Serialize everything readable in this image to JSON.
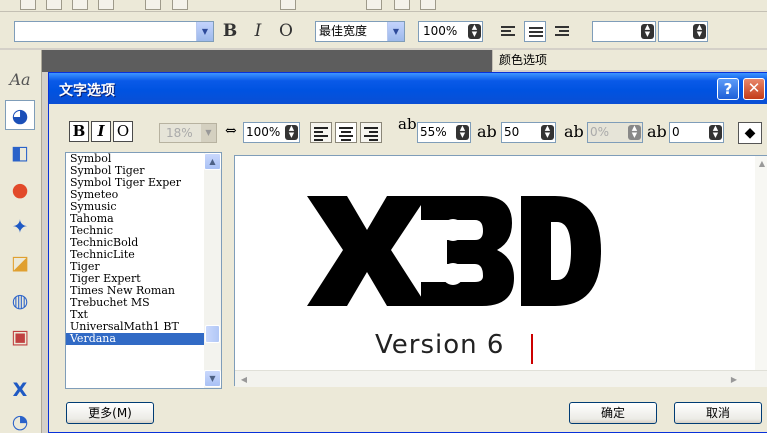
{
  "app_toolbar": {
    "font_name": "",
    "bold_label": "B",
    "italic_label": "I",
    "outline_label": "O",
    "width_mode": "最佳宽度",
    "zoom": "100%"
  },
  "color_panel": {
    "title": "颜色选项"
  },
  "sidebar": {
    "tools": [
      {
        "icon": "text-style-icon",
        "glyph": "Aa"
      },
      {
        "icon": "palette-icon",
        "glyph": "◕"
      },
      {
        "icon": "cube-icon",
        "glyph": "◧"
      },
      {
        "icon": "sphere-icon",
        "glyph": "●"
      },
      {
        "icon": "star-icon",
        "glyph": "✦"
      },
      {
        "icon": "shapes-icon",
        "glyph": "◪"
      },
      {
        "icon": "globe-icon",
        "glyph": "◍"
      },
      {
        "icon": "box-icon",
        "glyph": "▣"
      },
      {
        "icon": "x3d-logo-icon",
        "glyph": "X"
      },
      {
        "icon": "disc-icon",
        "glyph": "◔"
      }
    ]
  },
  "dialog": {
    "title": "文字选项",
    "help_label": "?",
    "close_label": "✕",
    "toolbar": {
      "bold_label": "B",
      "italic_label": "I",
      "outline_label": "O",
      "size": "18%",
      "width_scale": "100%",
      "line_spacing": "55%",
      "char_spacing": "50",
      "baseline_shift": "0%",
      "rotation": "0",
      "icon_width": "⇔",
      "icon_line": "ab",
      "icon_char": "ab",
      "icon_base": "ab",
      "icon_rot": "ab",
      "diamond": "◆"
    },
    "fonts": [
      "Symbol",
      "Symbol Tiger",
      "Symbol Tiger Exper",
      "Symeteo",
      "Symusic",
      "Tahoma",
      "Technic",
      "TechnicBold",
      "TechnicLite",
      "Tiger",
      "Tiger Expert",
      "Times New Roman",
      "Trebuchet MS",
      "Txt",
      "UniversalMath1 BT",
      "Verdana"
    ],
    "selected_font": "Verdana",
    "preview": {
      "logo_text": "X3D",
      "text": "Version 6"
    },
    "buttons": {
      "more": "更多(M)",
      "ok": "确定",
      "cancel": "取消"
    }
  }
}
